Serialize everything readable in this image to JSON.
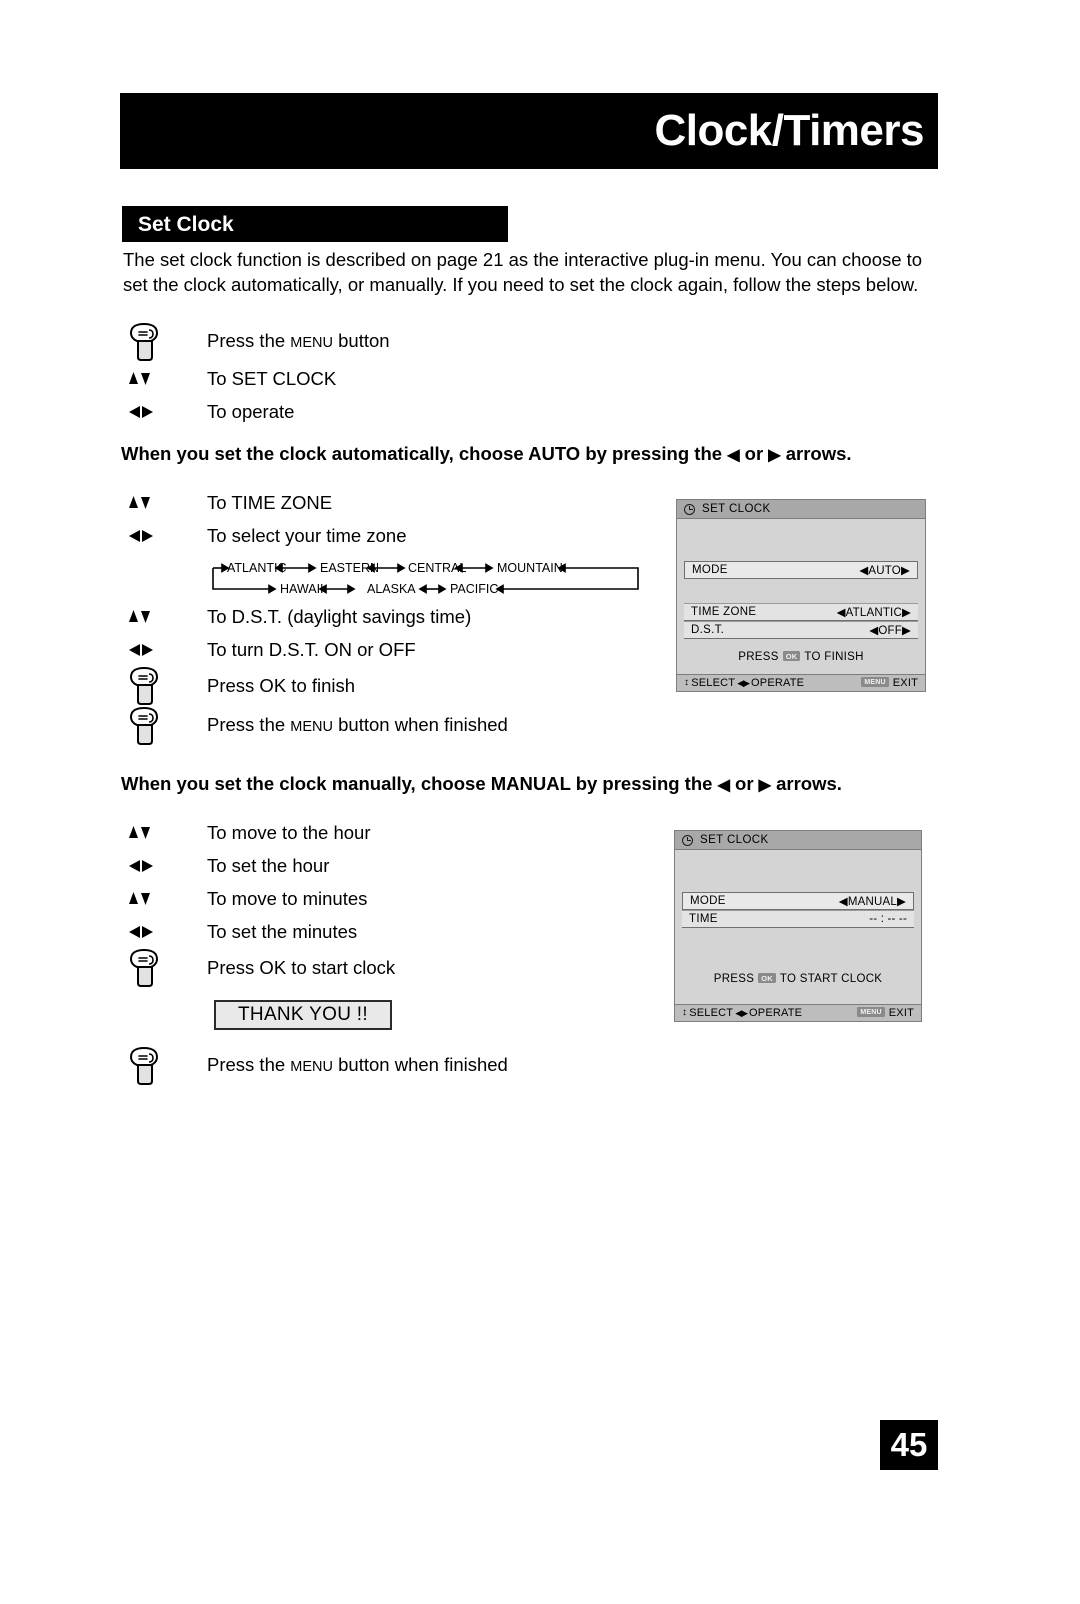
{
  "header": {
    "title": "Clock/Timers"
  },
  "section": {
    "title": "Set Clock"
  },
  "intro": {
    "text": "The set clock function is described on page 21 as the interactive plug-in menu. You can choose to set the clock automatically, or manually. If you need to set the clock again, follow the steps below."
  },
  "steps_intro": [
    {
      "icon": "hand-press-icon",
      "text_pre": "Press the ",
      "text_smallcap": "MENU",
      "text_post": " button"
    },
    {
      "icon": "up-down-arrows-icon",
      "text_pre": "To SET CLOCK",
      "text_smallcap": "",
      "text_post": ""
    },
    {
      "icon": "left-right-arrows-icon",
      "text_pre": "To operate",
      "text_smallcap": "",
      "text_post": ""
    }
  ],
  "callout_auto": {
    "pre": "When you set the clock automatically, choose AUTO by pressing the ",
    "left_arrow": "◀",
    "mid": " or ",
    "right_arrow": "▶",
    "post": " arrows."
  },
  "steps_auto": [
    {
      "icon": "up-down-arrows-icon",
      "text_pre": "To TIME ZONE",
      "text_smallcap": "",
      "text_post": ""
    },
    {
      "icon": "left-right-arrows-icon",
      "text_pre": "To select your time zone",
      "text_smallcap": "",
      "text_post": ""
    }
  ],
  "steps_auto2": [
    {
      "icon": "up-down-arrows-icon",
      "text_pre": "To D.S.T. (daylight savings time)",
      "text_smallcap": "",
      "text_post": ""
    },
    {
      "icon": "left-right-arrows-icon",
      "text_pre": "To turn D.S.T. ON or OFF",
      "text_smallcap": "",
      "text_post": ""
    },
    {
      "icon": "hand-press-icon",
      "text_pre": "Press OK to finish",
      "text_smallcap": "",
      "text_post": ""
    },
    {
      "icon": "hand-press-icon",
      "text_pre": "Press the ",
      "text_smallcap": "MENU",
      "text_post": " button when finished"
    }
  ],
  "timezone_diagram": {
    "row_top": [
      "ATLANTIC",
      "EASTERN",
      "CENTRAL",
      "MOUNTAIN"
    ],
    "row_bottom": [
      "HAWAII",
      "ALASKA",
      "PACIFIC"
    ]
  },
  "callout_manual": {
    "pre": "When you set the clock manually, choose MANUAL by pressing the ",
    "left_arrow": "◀",
    "mid": " or ",
    "right_arrow": "▶",
    "post": " arrows."
  },
  "steps_manual": [
    {
      "icon": "up-down-arrows-icon",
      "text_pre": "To move to the hour",
      "text_smallcap": "",
      "text_post": ""
    },
    {
      "icon": "left-right-arrows-icon",
      "text_pre": "To set the hour",
      "text_smallcap": "",
      "text_post": ""
    },
    {
      "icon": "up-down-arrows-icon",
      "text_pre": "To move to minutes",
      "text_smallcap": "",
      "text_post": ""
    },
    {
      "icon": "left-right-arrows-icon",
      "text_pre": "To set the minutes",
      "text_smallcap": "",
      "text_post": ""
    },
    {
      "icon": "hand-press-icon",
      "text_pre": "Press OK to start clock",
      "text_smallcap": "",
      "text_post": ""
    }
  ],
  "thank_you": {
    "label": "THANK YOU !!"
  },
  "final_step": {
    "icon": "hand-press-icon",
    "text_pre": "Press the ",
    "text_smallcap": "MENU",
    "text_post": " button when finished"
  },
  "osd_auto": {
    "title": "SET CLOCK",
    "rows": [
      {
        "label": "MODE",
        "value": "◀AUTO▶"
      },
      {
        "label": "TIME ZONE",
        "value": "◀ATLANTIC▶"
      },
      {
        "label": "D.S.T.",
        "value": "◀OFF▶"
      }
    ],
    "press_pre": "PRESS",
    "press_chip": "OK",
    "press_post": "TO FINISH",
    "footer_select": "SELECT",
    "footer_operate": "OPERATE",
    "footer_menu_chip": "MENU",
    "footer_exit": "EXIT"
  },
  "osd_manual": {
    "title": "SET CLOCK",
    "rows": [
      {
        "label": "MODE",
        "value": "◀MANUAL▶"
      },
      {
        "label": "TIME",
        "value": "-- : -- --"
      }
    ],
    "press_pre": "PRESS",
    "press_chip": "OK",
    "press_post": "TO START CLOCK",
    "footer_select": "SELECT",
    "footer_operate": "OPERATE",
    "footer_menu_chip": "MENU",
    "footer_exit": "EXIT"
  },
  "page_number": "45",
  "colors": {
    "header_bg": "#000000",
    "osd_bg": "#d4d4d4",
    "osd_title_bg": "#a8a8a8",
    "osd_footer_bg": "#bdbdbd",
    "thankyou_bg": "#e9e9e9"
  }
}
